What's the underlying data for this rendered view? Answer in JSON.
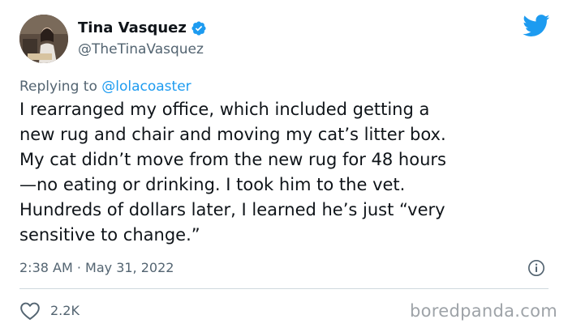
{
  "author": {
    "display_name": "Tina Vasquez",
    "handle": "@TheTinaVasquez",
    "verified": true
  },
  "reply": {
    "prefix": "Replying to ",
    "mention": "@lolacoaster"
  },
  "tweet": {
    "lines": [
      "I rearranged my office, which included getting a",
      "new rug and chair and moving my cat’s litter box.",
      "My cat didn’t move from the new rug for 48 hours",
      "—no eating or drinking. I took him to the vet.",
      "Hundreds of dollars later, I learned he’s just “very",
      "sensitive to change.”"
    ]
  },
  "meta": {
    "timestamp": "2:38 AM · May 31, 2022"
  },
  "engagement": {
    "likes": "2.2K"
  },
  "watermark": "boredpanda.com",
  "icons": {
    "brand": "twitter-bird-icon",
    "verified": "verified-badge-icon",
    "info": "info-icon",
    "like": "heart-icon"
  },
  "colors": {
    "accent": "#1d9bf0",
    "text": "#0f1419",
    "secondary": "#536471",
    "divider": "#cfd9de"
  }
}
